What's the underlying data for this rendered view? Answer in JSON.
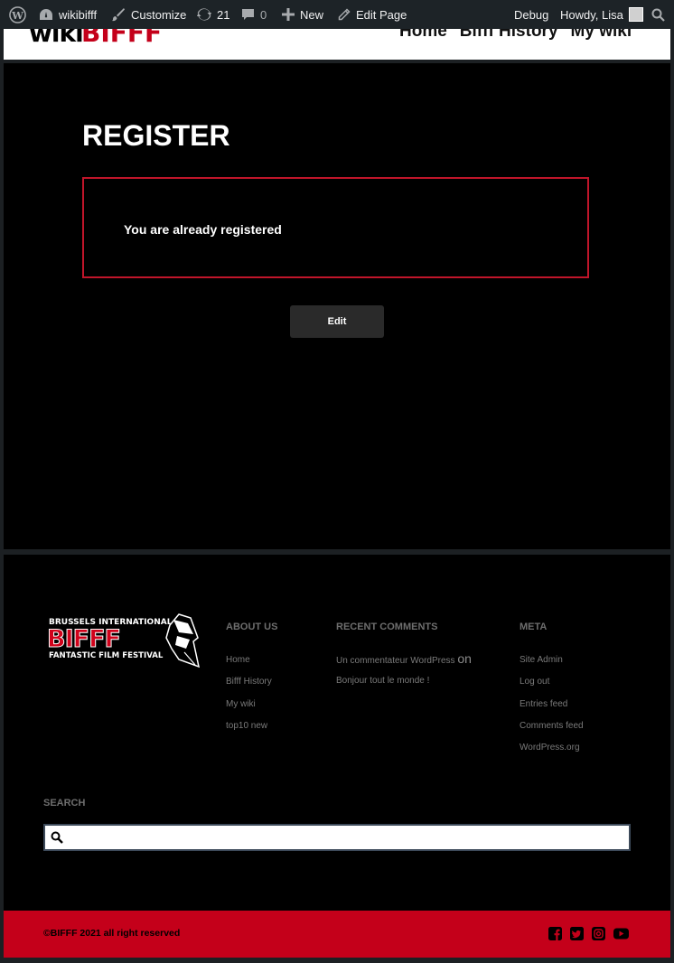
{
  "adminbar": {
    "site_name": "wikibifff",
    "customize": "Customize",
    "updates_count": "21",
    "comments_count": "0",
    "new": "New",
    "edit_page": "Edit Page",
    "debug": "Debug",
    "howdy": "Howdy, Lisa"
  },
  "header": {
    "logo_wiki": "wiki",
    "logo_bifff": "BIFFF",
    "nav": [
      "Home",
      "Bifff History",
      "My wiki"
    ]
  },
  "main": {
    "title": "REGISTER",
    "notice": "You are already registered",
    "edit_button": "Edit"
  },
  "footer": {
    "logo": {
      "line1": "BRUSSELS INTERNATIONAL",
      "word": "BIFFF",
      "line2": "FANTASTIC FILM FESTIVAL"
    },
    "about": {
      "title": "ABOUT US",
      "links": [
        "Home",
        "Bifff History",
        "My wiki",
        "top10 new"
      ]
    },
    "recent_comments": {
      "title": "RECENT COMMENTS",
      "author": "Un commentateur WordPress",
      "on": "on",
      "post": "Bonjour tout le monde !"
    },
    "meta": {
      "title": "META",
      "links": [
        "Site Admin",
        "Log out",
        "Entries feed",
        "Comments feed",
        "WordPress.org"
      ]
    },
    "search": {
      "title": "SEARCH",
      "placeholder": ""
    }
  },
  "bottom": {
    "copyright": "©BIFFF 2021 all right reserved",
    "social": [
      "facebook-icon",
      "twitter-icon",
      "instagram-icon",
      "youtube-icon"
    ]
  },
  "colors": {
    "accent_red": "#c4001a",
    "admin_bar": "#1d2327"
  }
}
